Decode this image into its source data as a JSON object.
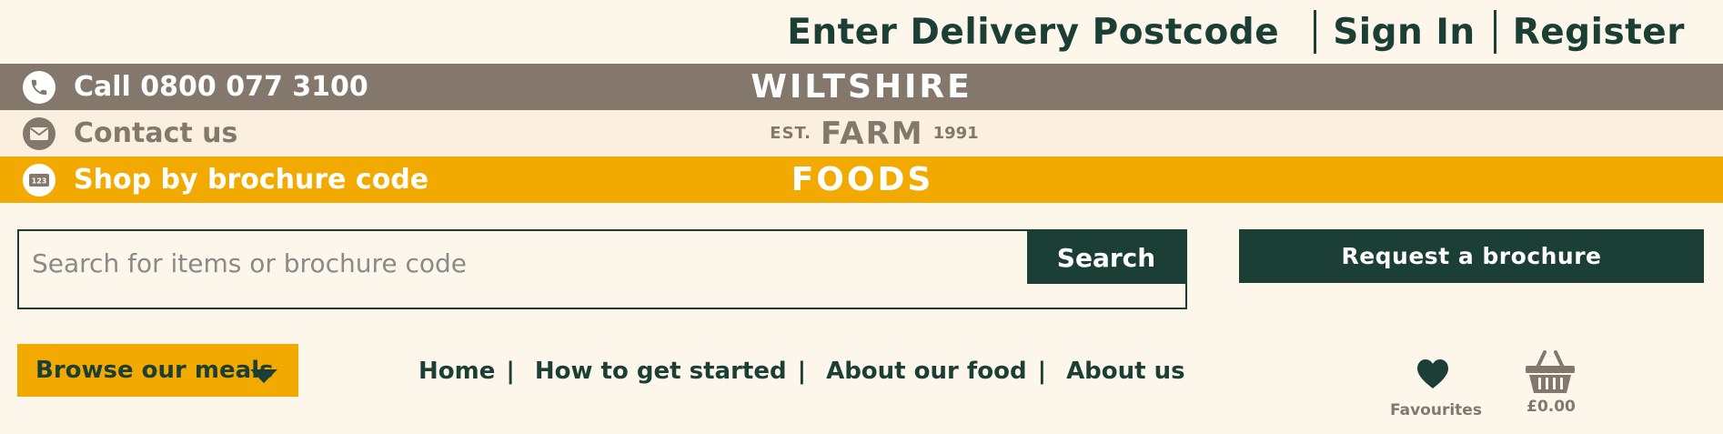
{
  "header": {
    "delivery_postcode": "Enter Delivery Postcode",
    "sign_in": "Sign In",
    "register": "Register"
  },
  "contact": {
    "call_label": "Call 0800 077 3100",
    "contact_label": "Contact us",
    "brochure_code_label": "Shop by brochure code",
    "brochure_code_icon_text": "123"
  },
  "logo": {
    "line1": "WILTSHIRE",
    "est": "EST.",
    "farm": "FARM",
    "year": "1991",
    "line3": "FOODS"
  },
  "search": {
    "placeholder": "Search for items or brochure code",
    "button_label": "Search"
  },
  "brochure": {
    "button_label": "Request a brochure"
  },
  "browse": {
    "label": "Browse our meals"
  },
  "nav": {
    "items": [
      {
        "label": "Home"
      },
      {
        "label": "How to get started"
      },
      {
        "label": "About our food"
      },
      {
        "label": "About us"
      }
    ],
    "separator": "|"
  },
  "favourites": {
    "label": "Favourites"
  },
  "basket": {
    "total": "£0.00"
  },
  "colors": {
    "background": "#fdf6ea",
    "brand_green": "#1b3f35",
    "taupe": "#84786d",
    "yellow": "#f2aa00",
    "white": "#ffffff"
  },
  "icons": {
    "call": "phone-icon",
    "contact": "envelope-icon",
    "brochure_code": "number-code-icon",
    "browse_caret": "chevron-down-icon",
    "favourites": "heart-icon",
    "basket": "basket-icon"
  }
}
